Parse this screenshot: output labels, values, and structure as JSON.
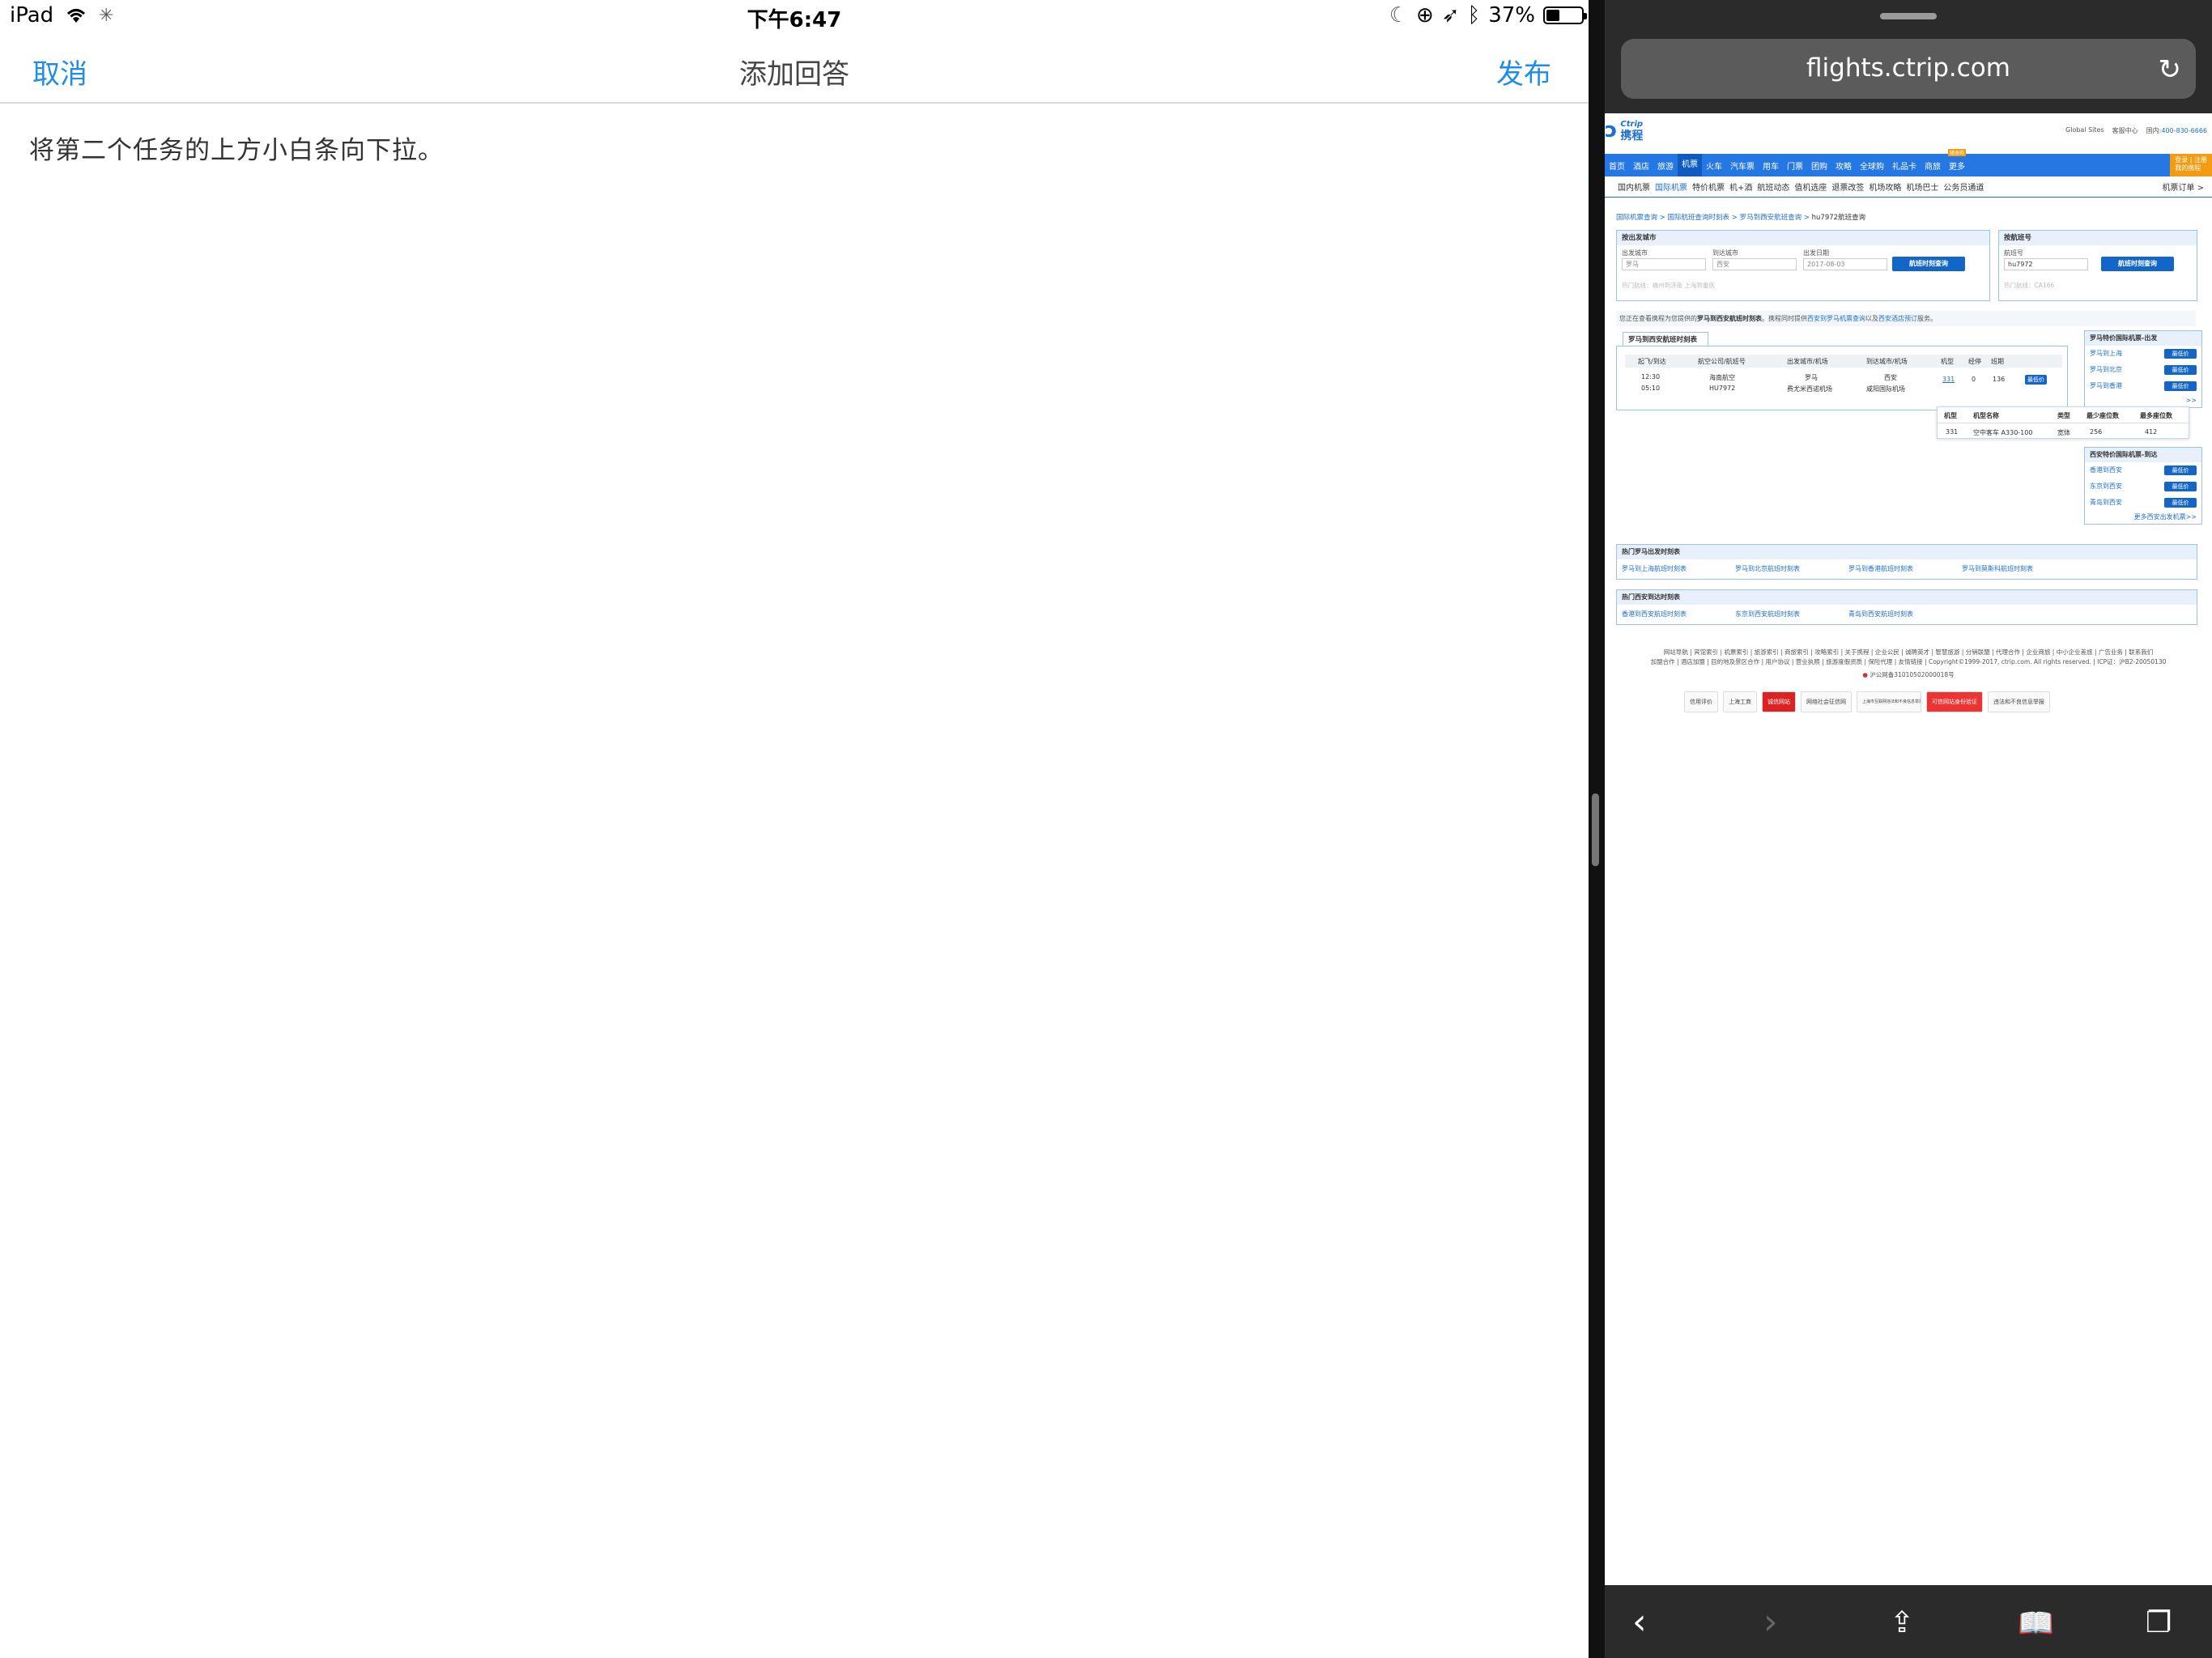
{
  "status": {
    "device": "iPad",
    "time": "下午6:47",
    "battery": "37%",
    "battery_level": 0.37
  },
  "navbar": {
    "cancel": "取消",
    "title": "添加回答",
    "publish": "发布"
  },
  "answer_text": "将第二个任务的上方小白条向下拉。",
  "safari": {
    "url": "flights.ctrip.com"
  },
  "site": {
    "logo_text": "携程",
    "logo_en": "Ctrip",
    "top_links": [
      "Global Sites",
      "客服中心",
      "国内:",
      "400-830-6666"
    ],
    "nav": [
      "首页",
      "酒店",
      "旅游",
      "机票",
      "火车",
      "汽车票",
      "用车",
      "门票",
      "团购",
      "攻略",
      "全球购",
      "礼品卡",
      "商旅",
      "更多"
    ],
    "nav_badge": "随身购",
    "login": "登录 | 注册",
    "my_ctrip": "我的携程",
    "subnav": [
      "国内机票",
      "国际机票",
      "特价机票",
      "机+酒",
      "航班动态",
      "值机选座",
      "退票改签",
      "机场攻略",
      "机场巴士",
      "公务员通道"
    ],
    "orders": "机票订单 >",
    "breadcrumb": [
      "国际机票查询",
      "国际航班查询时刻表",
      "罗马到西安航班查询",
      "hu7972航班查询"
    ],
    "city_search": {
      "header": "按出发城市",
      "from_label": "出发城市",
      "to_label": "到达城市",
      "date_label": "出发日期",
      "from": "罗马",
      "to": "西安",
      "date": "2017-08-03",
      "button": "航班时刻查询",
      "hint": "热门航线：福州到济南 上海到重庆"
    },
    "flight_search": {
      "header": "按航班号",
      "label": "航班号",
      "value": "hu7972",
      "button": "航班时刻查询",
      "hint": "热门航线：CA166"
    },
    "notice": {
      "prefix": "您正在查看携程为您提供的",
      "bold": "罗马到西安航班时刻表",
      "middle": "。携程同时提供",
      "link1": "西安到罗马机票查询",
      "and": "以及",
      "link2": "西安酒店预订",
      "suffix": "服务。"
    },
    "schedule": {
      "tab": "罗马到西安航班时刻表",
      "headers": [
        "起飞/到达",
        "航空公司/航班号",
        "出发城市/机场",
        "到达城市/机场",
        "机型",
        "经停",
        "班期"
      ],
      "row1": [
        "12:30",
        "海南航空",
        "罗马",
        "西安",
        "331",
        "0",
        "136"
      ],
      "row2": [
        "05:10",
        "HU7972",
        "费尤米西诺机场",
        "咸阳国际机场"
      ],
      "price_btn": "最低价"
    },
    "popup": {
      "headers": [
        "机型",
        "机型名称",
        "类型",
        "最少座位数",
        "最多座位数"
      ],
      "values": [
        "331",
        "空中客车 A330-100",
        "宽体",
        "256",
        "412"
      ]
    },
    "side_from": {
      "header": "罗马特价国际机票-出发",
      "items": [
        "罗马到上海",
        "罗马到北京",
        "罗马到香港"
      ],
      "btn": "最低价",
      "more": ">>"
    },
    "side_to": {
      "header": "西安特价国际机票-到达",
      "items": [
        "香港到西安",
        "东京到西安",
        "青岛到西安"
      ],
      "btn": "最低价",
      "more": "更多西安出发机票>>"
    },
    "hot_from": {
      "header": "热门罗马出发时刻表",
      "links": [
        "罗马到上海航班时刻表",
        "罗马到北京航班时刻表",
        "罗马到香港航班时刻表",
        "罗马到莫斯科航班时刻表"
      ]
    },
    "hot_to": {
      "header": "热门西安到达时刻表",
      "links": [
        "香港到西安航班时刻表",
        "东京到西安航班时刻表",
        "青岛到西安航班时刻表"
      ]
    },
    "footer": {
      "line1": "网站导航 | 宾馆索引 | 机票索引 | 旅游索引 | 商旅索引 | 攻略索引 | 关于携程 | 企业公民 | 诚聘英才 | 智慧旅游 | 分销联盟 | 代理合作 | 企业商旅 | 中小企业差旅 | 广告业务 | 联系我们",
      "line2": "加盟合作 | 酒店加盟 | 目的地及景区合作 | 用户协议 | 营业执照 | 旅游度假资质 | 保险代理 | 友情链接 | Copyright©1999-2017, ctrip.com. All rights reserved. | ICP证：沪B2-20050130",
      "police": "沪公网备31010502000018号",
      "badges": [
        "信用评价",
        "上海工商",
        "诚信网站",
        "网络社会征信网",
        "上海市互联网违法和不良信息举报中心",
        "可信网站身份验证",
        "违法和不良信息举报"
      ]
    }
  }
}
